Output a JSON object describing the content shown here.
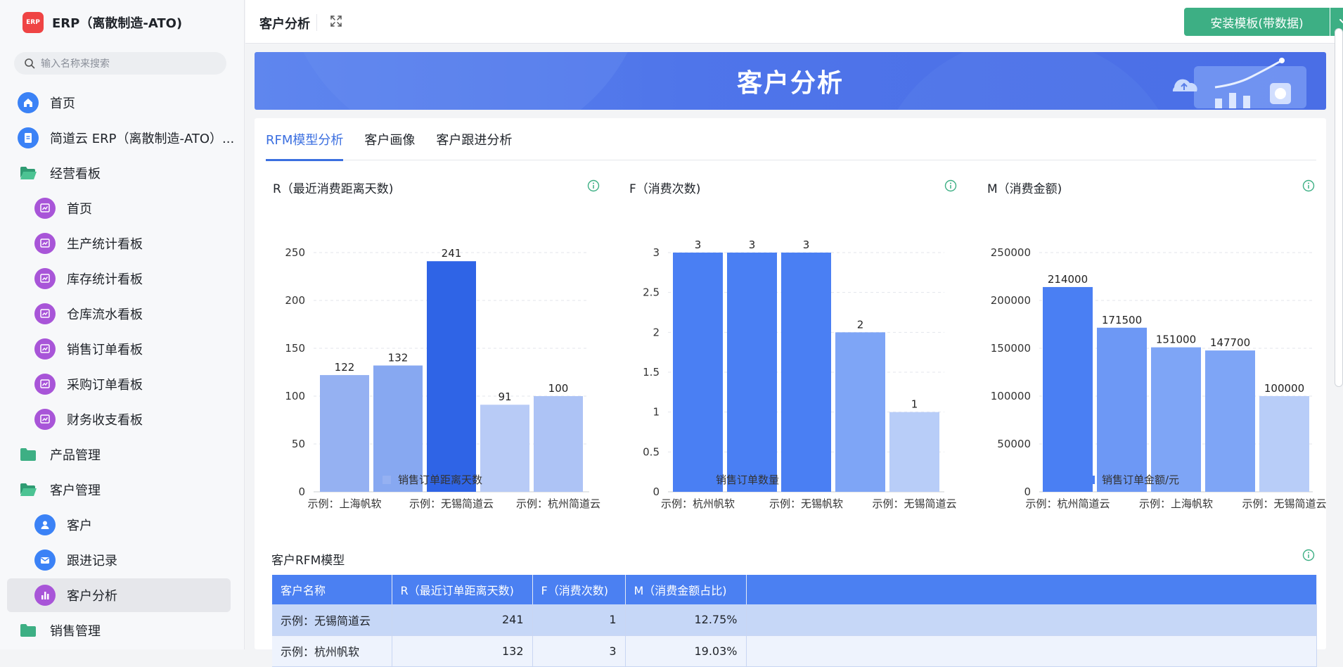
{
  "app": {
    "title": "ERP（离散制造-ATO)",
    "logo_text": "ERP",
    "search_placeholder": "输入名称来搜索"
  },
  "nav": [
    {
      "label": "首页",
      "level": 1,
      "icon": "home-icon"
    },
    {
      "label": "简道云 ERP（离散制造-ATO）...",
      "level": 1,
      "icon": "document-icon"
    },
    {
      "label": "经营看板",
      "level": 1,
      "icon": "folder-open-icon"
    },
    {
      "label": "首页",
      "level": 2,
      "icon": "dashboard-icon"
    },
    {
      "label": "生产统计看板",
      "level": 2,
      "icon": "dashboard-icon"
    },
    {
      "label": "库存统计看板",
      "level": 2,
      "icon": "dashboard-icon"
    },
    {
      "label": "仓库流水看板",
      "level": 2,
      "icon": "dashboard-icon"
    },
    {
      "label": "销售订单看板",
      "level": 2,
      "icon": "dashboard-icon"
    },
    {
      "label": "采购订单看板",
      "level": 2,
      "icon": "dashboard-icon"
    },
    {
      "label": "财务收支看板",
      "level": 2,
      "icon": "dashboard-icon"
    },
    {
      "label": "产品管理",
      "level": 1,
      "icon": "folder-icon"
    },
    {
      "label": "客户管理",
      "level": 1,
      "icon": "folder-open-icon"
    },
    {
      "label": "客户",
      "level": 2,
      "icon": "user-icon"
    },
    {
      "label": "跟进记录",
      "level": 2,
      "icon": "mail-icon"
    },
    {
      "label": "客户分析",
      "level": 2,
      "icon": "bar-chart-icon",
      "active": true
    },
    {
      "label": "销售管理",
      "level": 1,
      "icon": "folder-icon"
    }
  ],
  "topbar": {
    "page_title": "客户分析",
    "install_button": "安装模板(带数据)"
  },
  "banner": {
    "title": "客户分析"
  },
  "tabs": [
    {
      "label": "RFM模型分析",
      "active": true
    },
    {
      "label": "客户画像",
      "active": false
    },
    {
      "label": "客户跟进分析",
      "active": false
    }
  ],
  "colors": {
    "accent": "#3b6fe0",
    "install": "#3daf84",
    "header_row": "#4b80f2"
  },
  "chart_data": [
    {
      "type": "bar",
      "title": "R（最近消费距离天数)",
      "categories": [
        "示例：上海帆软",
        "",
        "示例：无锡简道云",
        "",
        "示例：杭州简道云"
      ],
      "values": [
        122,
        132,
        241,
        91,
        100
      ],
      "colors": [
        "#95b1f2",
        "#87a8f1",
        "#2f64e6",
        "#b8cbf6",
        "#adc3f5"
      ],
      "ylim": [
        0,
        250
      ],
      "yticks": [
        "0",
        "50",
        "100",
        "150",
        "200",
        "250"
      ],
      "legend": "销售订单距离天数",
      "legend_color": "#95b1f2"
    },
    {
      "type": "bar",
      "title": "F（消费次数)",
      "categories": [
        "示例：杭州帆软",
        "",
        "示例：无锡帆软",
        "",
        "示例：无锡简道云"
      ],
      "values": [
        3,
        3,
        3,
        2,
        1
      ],
      "colors": [
        "#4a7ff3",
        "#4a7ff3",
        "#4a7ff3",
        "#7ea5f6",
        "#b8cdf8"
      ],
      "ylim": [
        0,
        3
      ],
      "yticks": [
        "0",
        "0.5",
        "1",
        "1.5",
        "2",
        "2.5",
        "3"
      ],
      "legend": "销售订单数量",
      "legend_color": "#4a7ff3"
    },
    {
      "type": "bar",
      "title": "M（消费金额)",
      "categories": [
        "示例：杭州简道云",
        "",
        "示例：上海帆软",
        "",
        "示例：无锡简道云"
      ],
      "values": [
        214000,
        171500,
        151000,
        147700,
        100000
      ],
      "colors": [
        "#4a7ff3",
        "#6d98f5",
        "#7ea5f6",
        "#7ea5f6",
        "#b8cdf8"
      ],
      "ylim": [
        0,
        250000
      ],
      "yticks": [
        "0",
        "50000",
        "100000",
        "150000",
        "200000",
        "250000"
      ],
      "legend": "销售订单金额/元",
      "legend_color": "#4a7ff3"
    }
  ],
  "table": {
    "title": "客户RFM模型",
    "headers": [
      "客户名称",
      "R（最近订单距离天数)",
      "F（消费次数)",
      "M（消费金额占比)",
      ""
    ],
    "rows": [
      [
        "示例：无锡简道云",
        "241",
        "1",
        "12.75%",
        ""
      ],
      [
        "示例：杭州帆软",
        "132",
        "3",
        "19.03%",
        ""
      ]
    ]
  }
}
